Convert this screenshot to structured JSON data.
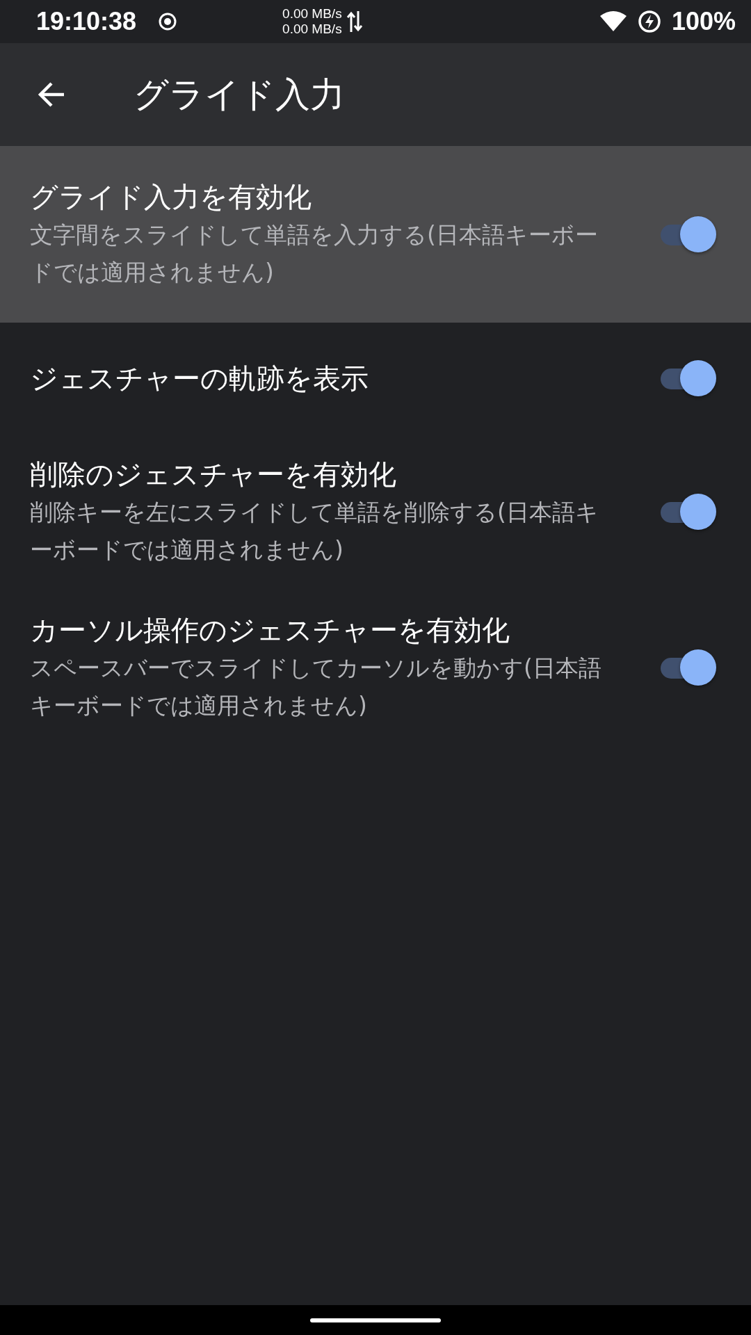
{
  "status_bar": {
    "time": "19:10:38",
    "upload_speed": "0.00 MB/s",
    "download_speed": "0.00 MB/s",
    "battery": "100%"
  },
  "toolbar": {
    "title": "グライド入力"
  },
  "settings": [
    {
      "title": "グライド入力を有効化",
      "summary": "文字間をスライドして単語を入力する(日本語キーボードでは適用されません)",
      "on": true,
      "pressed": true
    },
    {
      "title": "ジェスチャーの軌跡を表示",
      "on": true,
      "pressed": false
    },
    {
      "title": "削除のジェスチャーを有効化",
      "summary": "削除キーを左にスライドして単語を削除する(日本語キーボードでは適用されません)",
      "on": true,
      "pressed": false
    },
    {
      "title": "カーソル操作のジェスチャーを有効化",
      "summary": "スペースバーでスライドしてカーソルを動かす(日本語キーボードでは適用されません)",
      "on": true,
      "pressed": false
    }
  ]
}
